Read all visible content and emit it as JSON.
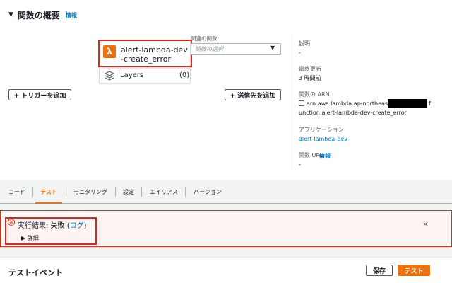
{
  "overview": {
    "title": "関数の概要",
    "info_link": "情報"
  },
  "function": {
    "name": "alert-lambda-dev-create_error",
    "layers_label": "Layers",
    "layers_count": "(0)"
  },
  "related": {
    "label": "関連の関数:",
    "placeholder": "関数の選択"
  },
  "buttons": {
    "add_trigger": "+ トリガーを追加",
    "add_destination": "+ 送信先を追加",
    "save": "保存",
    "test": "テスト"
  },
  "meta": {
    "description_label": "説明",
    "description_value": "-",
    "last_modified_label": "最終更新",
    "last_modified_value": "3 時間前",
    "arn_label": "関数の ARN",
    "arn_line1_prefix": "arn:aws:lambda:ap-northeast-1",
    "arn_line1_suffix": "f",
    "arn_line2": "unction:alert-lambda-dev-create_error",
    "application_label": "アプリケーション",
    "application_value": "alert-lambda-dev",
    "url_label": "関数 URL",
    "url_info": "情報",
    "url_value": "-"
  },
  "tabs": [
    {
      "label": "コード",
      "active": false
    },
    {
      "label": "テスト",
      "active": true
    },
    {
      "label": "モニタリング",
      "active": false
    },
    {
      "label": "設定",
      "active": false
    },
    {
      "label": "エイリアス",
      "active": false
    },
    {
      "label": "バージョン",
      "active": false
    }
  ],
  "alert": {
    "title_prefix": "実行結果: 失敗 (",
    "log_link": "ログ",
    "title_suffix": ")",
    "details": "詳細",
    "close": "×"
  },
  "test_event": {
    "title": "テストイベント"
  },
  "colors": {
    "accent": "#ec7211",
    "link": "#0073bb",
    "error": "#d13212",
    "highlight": "#e0251e"
  }
}
